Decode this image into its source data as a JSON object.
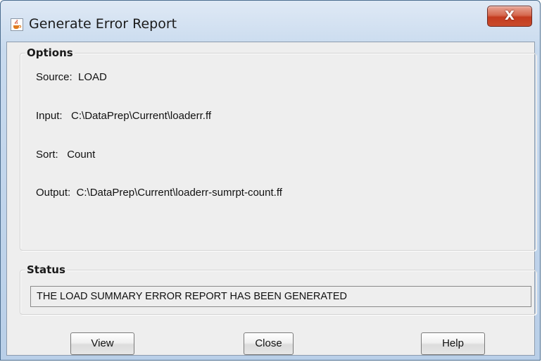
{
  "window": {
    "title": "Generate Error Report",
    "close_label": "X"
  },
  "options": {
    "legend": "Options",
    "source_label": "Source:",
    "source_value": "LOAD",
    "input_label": "Input:",
    "input_value": "C:\\DataPrep\\Current\\loaderr.ff",
    "sort_label": "Sort:",
    "sort_value": "Count",
    "output_label": "Output:",
    "output_value": "C:\\DataPrep\\Current\\loaderr-sumrpt-count.ff"
  },
  "status": {
    "legend": "Status",
    "message": "THE LOAD SUMMARY ERROR REPORT HAS BEEN GENERATED"
  },
  "buttons": {
    "view": "View",
    "close": "Close",
    "help": "Help"
  },
  "icons": {
    "app": "java-coffee-cup-icon",
    "close": "close-icon"
  }
}
